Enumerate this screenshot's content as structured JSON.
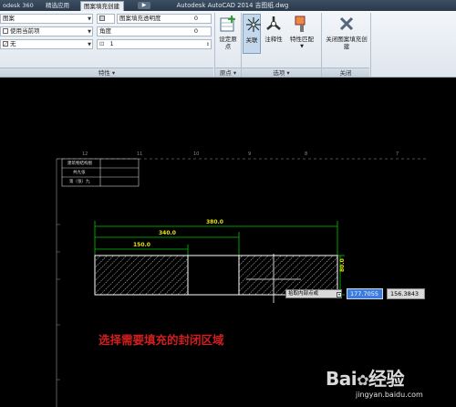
{
  "titlebar": {
    "tabs": [
      "odesk 360",
      "精选应用",
      "图案填充创建"
    ],
    "extra_tab_icon": "video-icon",
    "title": "Autodesk AutoCAD 2014   吉图纸.dwg"
  },
  "ribbon": {
    "properties": {
      "pattern_label": "图案",
      "color_label": "使用当前项",
      "background_label": "无",
      "transparency_label": "图案填充透明度",
      "transparency_value": "0",
      "angle_label": "角度",
      "angle_value": "0",
      "scale_value": "1",
      "panel_title": "特性 ▾"
    },
    "origin": {
      "set_origin_label": "设定原点",
      "panel_title": "原点 ▾"
    },
    "options": {
      "associative_label": "关联",
      "annotative_label": "注释性",
      "match_label": "特性匹配",
      "panel_title": "选项 ▾"
    },
    "close": {
      "close_label": "关闭图案填充创建",
      "panel_title": "关闭"
    }
  },
  "drawing": {
    "ruler_numbers": [
      "12",
      "11",
      "10",
      "9",
      "8",
      "7"
    ],
    "titleblock": [
      "建筑物结构图",
      "共九张",
      "第（张）九"
    ],
    "dims": {
      "overall": "380.0",
      "middle": "340.0",
      "left": "150.0",
      "side": "80.0"
    },
    "tooltip": "拾取内部点或",
    "coord_x": "177.7055",
    "coord_y": "156.3843",
    "instruction": "选择需要填充的封闭区域"
  },
  "watermark": {
    "logo": "Bai 经验",
    "url": "jingyan.baidu.com"
  },
  "colors": {
    "accent": "#3a7ce0",
    "instruction": "#d21e1e",
    "geometry": "#ffffff",
    "dimension": "#00c800"
  }
}
